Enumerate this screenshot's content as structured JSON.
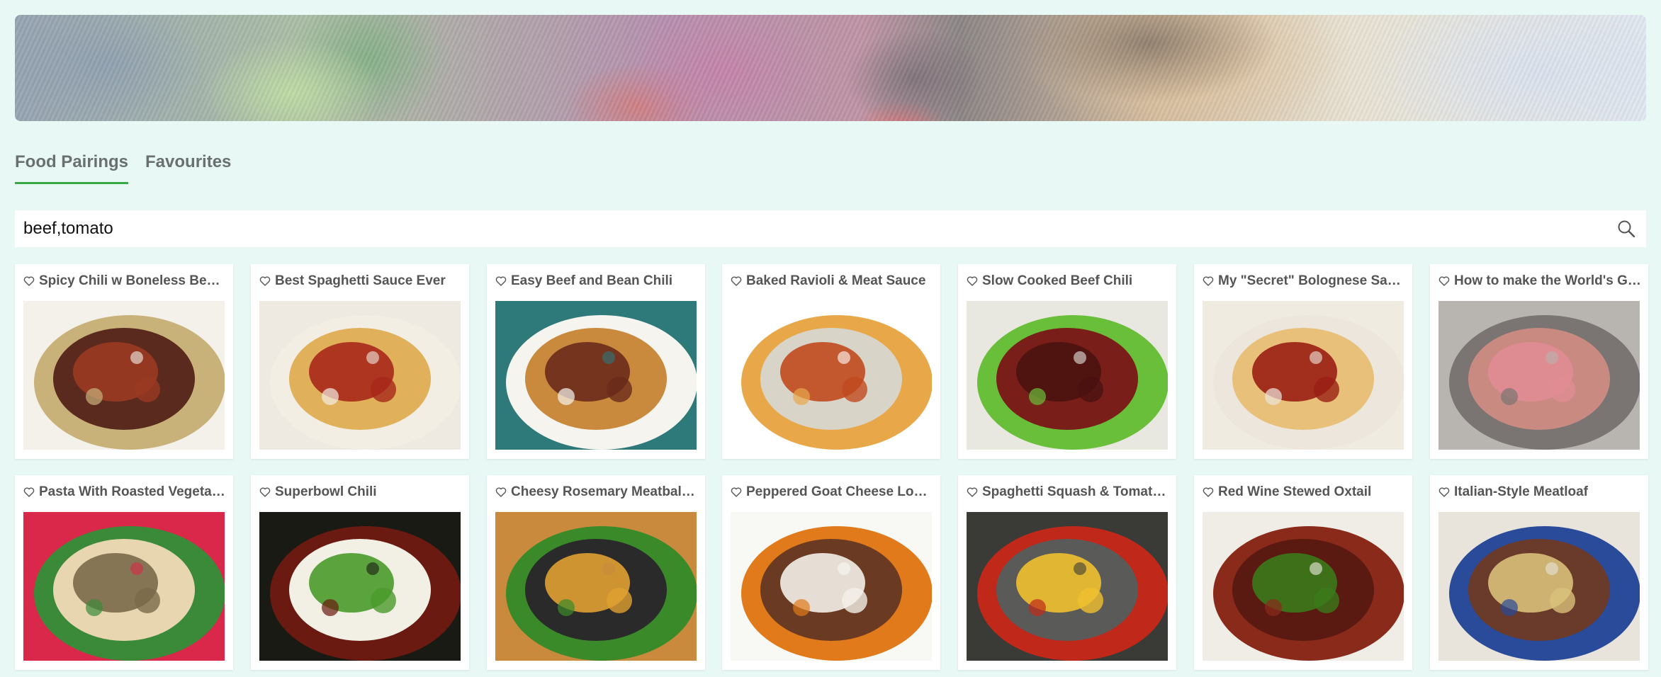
{
  "tabs": [
    {
      "label": "Food Pairings",
      "active": true
    },
    {
      "label": "Favourites",
      "active": false
    }
  ],
  "search": {
    "value": "beef,tomato",
    "icon": "search-icon"
  },
  "accent_color": "#39a845",
  "recipes": [
    {
      "title": "Spicy Chili w Boneless Beef Short Ribs",
      "favourite": false,
      "image_palette": [
        "#f4f1ea",
        "#5a2a1e",
        "#9a3a22",
        "#c9b27a"
      ]
    },
    {
      "title": "Best Spaghetti Sauce Ever",
      "favourite": false,
      "image_palette": [
        "#eeeae2",
        "#e0b05a",
        "#a8281a",
        "#f2eee4"
      ]
    },
    {
      "title": "Easy Beef and Bean Chili",
      "favourite": false,
      "image_palette": [
        "#2e7a7a",
        "#c98a3e",
        "#6a2a1a",
        "#f6f4ee"
      ]
    },
    {
      "title": "Baked Ravioli & Meat Sauce",
      "favourite": false,
      "image_palette": [
        "#ffffff",
        "#d9d4c8",
        "#c04a1e",
        "#e8a84a"
      ]
    },
    {
      "title": "Slow Cooked Beef Chili",
      "favourite": false,
      "image_palette": [
        "#e8e8e0",
        "#7a1e1a",
        "#4a1210",
        "#6abf3a"
      ]
    },
    {
      "title": "My \"Secret\" Bolognese Sauce",
      "favourite": false,
      "image_palette": [
        "#f0ebe0",
        "#e8c07a",
        "#9a1e14",
        "#ece6dc"
      ]
    },
    {
      "title": "How to make the World's Greatest Burger",
      "favourite": false,
      "image_palette": [
        "#b8b4b0",
        "#c98a82",
        "#e08c92",
        "#7a7472"
      ]
    },
    {
      "title": "Pasta With Roasted Vegetables and Meatballs",
      "favourite": false,
      "image_palette": [
        "#d9284a",
        "#e8d6b0",
        "#7a6a4a",
        "#3a8a3a"
      ]
    },
    {
      "title": "Superbowl Chili",
      "favourite": false,
      "image_palette": [
        "#1a1a14",
        "#f2efe4",
        "#4a9a2a",
        "#6a1a10"
      ]
    },
    {
      "title": "Cheesy Rosemary Meatball Skillet",
      "favourite": false,
      "image_palette": [
        "#c98a3e",
        "#2a2a2a",
        "#e0a032",
        "#3a8a2a"
      ]
    },
    {
      "title": "Peppered Goat Cheese Log Burgers",
      "favourite": false,
      "image_palette": [
        "#f8f8f4",
        "#6a3a22",
        "#f4f0e8",
        "#e07a1a"
      ]
    },
    {
      "title": "Spaghetti Squash & Tomato Sauce",
      "favourite": false,
      "image_palette": [
        "#3a3a36",
        "#5a5a58",
        "#f0c030",
        "#c0281a"
      ]
    },
    {
      "title": "Red Wine Stewed Oxtail",
      "favourite": false,
      "image_palette": [
        "#f0ece6",
        "#5a1a12",
        "#3a7a1a",
        "#8a2a1a"
      ]
    },
    {
      "title": "Italian-Style Meatloaf",
      "favourite": false,
      "image_palette": [
        "#e8e4dc",
        "#6a3a2a",
        "#d9c07a",
        "#2a4a9a"
      ]
    }
  ]
}
